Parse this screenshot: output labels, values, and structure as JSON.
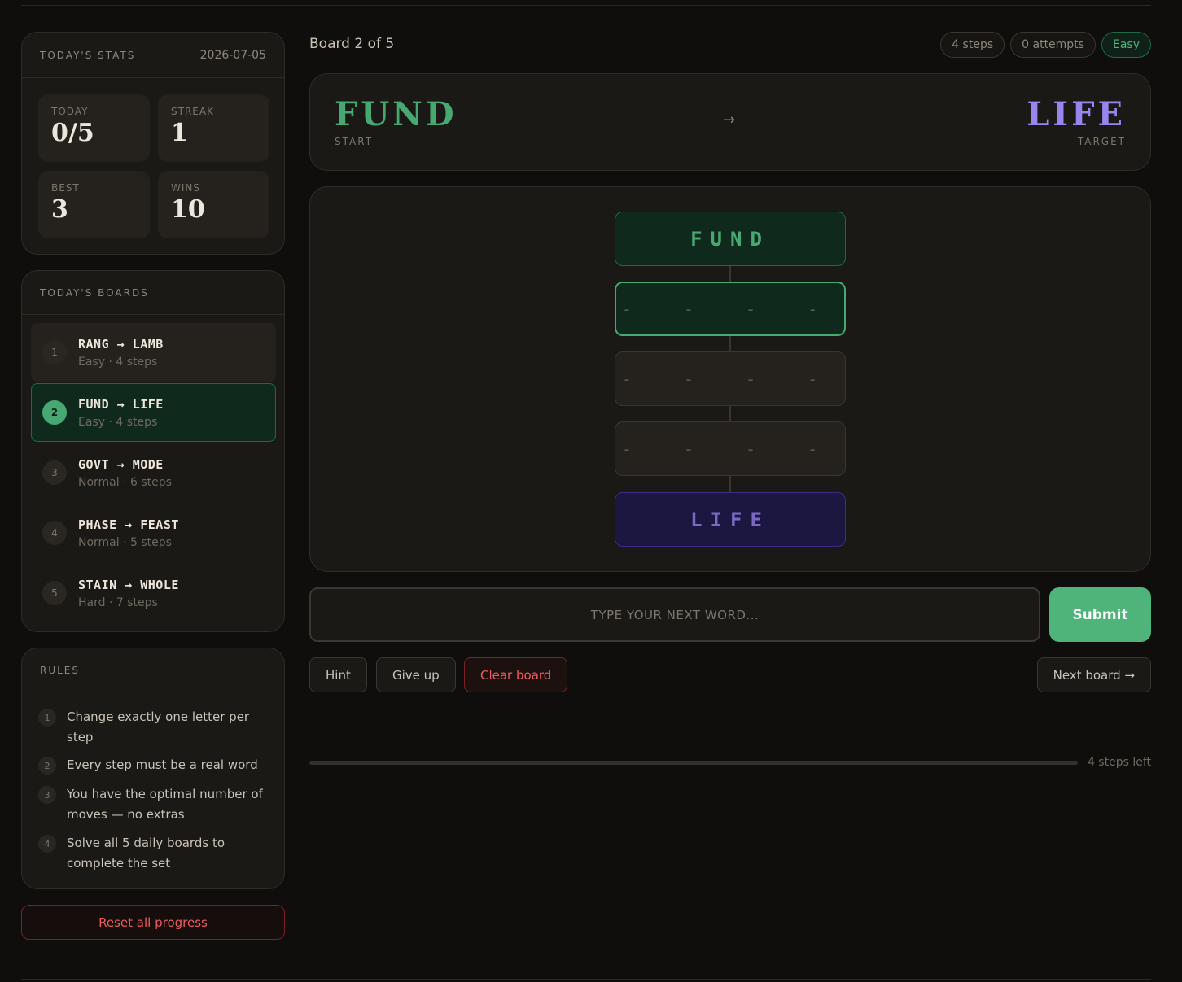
{
  "sidebar": {
    "stats": {
      "title": "Today's stats",
      "date": "2026-07-05",
      "items": [
        {
          "label": "Today",
          "value": "0/5"
        },
        {
          "label": "Streak",
          "value": "1"
        },
        {
          "label": "Best",
          "value": "3"
        },
        {
          "label": "Wins",
          "value": "10"
        }
      ]
    },
    "boards": {
      "title": "Today's boards",
      "items": [
        {
          "num": "1",
          "words": "RANG → LAMB",
          "meta": "Easy · 4 steps",
          "state": "dim"
        },
        {
          "num": "2",
          "words": "FUND → LIFE",
          "meta": "Easy · 4 steps",
          "state": "active"
        },
        {
          "num": "3",
          "words": "GOVT → MODE",
          "meta": "Normal · 6 steps",
          "state": ""
        },
        {
          "num": "4",
          "words": "PHASE → FEAST",
          "meta": "Normal · 5 steps",
          "state": ""
        },
        {
          "num": "5",
          "words": "STAIN → WHOLE",
          "meta": "Hard · 7 steps",
          "state": ""
        }
      ]
    },
    "rules": {
      "title": "Rules",
      "items": [
        {
          "num": "1",
          "text": "Change exactly one letter per step"
        },
        {
          "num": "2",
          "text": "Every step must be a real word"
        },
        {
          "num": "3",
          "text": "You have the optimal number of moves — no extras"
        },
        {
          "num": "4",
          "text": "Solve all 5 daily boards to complete the set"
        }
      ]
    },
    "reset_label": "Reset all progress"
  },
  "main": {
    "board_title": "Board 2 of 5",
    "pills": {
      "steps": "4 steps",
      "attempts": "0 attempts",
      "difficulty": "Easy"
    },
    "start": {
      "word": "FUND",
      "label": "START"
    },
    "target": {
      "word": "LIFE",
      "label": "TARGET"
    },
    "arrow": "→",
    "ladder": [
      {
        "text": "FUND",
        "state": "start"
      },
      {
        "text": "- - - -",
        "state": "current"
      },
      {
        "text": "- - - -",
        "state": "empty"
      },
      {
        "text": "- - - -",
        "state": "empty"
      },
      {
        "text": "LIFE",
        "state": "target"
      }
    ],
    "input": {
      "placeholder": "Type your next word...",
      "value": ""
    },
    "submit_label": "Submit",
    "actions": {
      "hint": "Hint",
      "give_up": "Give up",
      "clear": "Clear board",
      "next": "Next board →"
    },
    "progress": {
      "fraction": 0,
      "label": "4 steps left"
    }
  },
  "colors": {
    "accent": "#47a872",
    "target": "#9a85ee",
    "danger": "#ef5a5f",
    "submit": "#4fb47a"
  }
}
